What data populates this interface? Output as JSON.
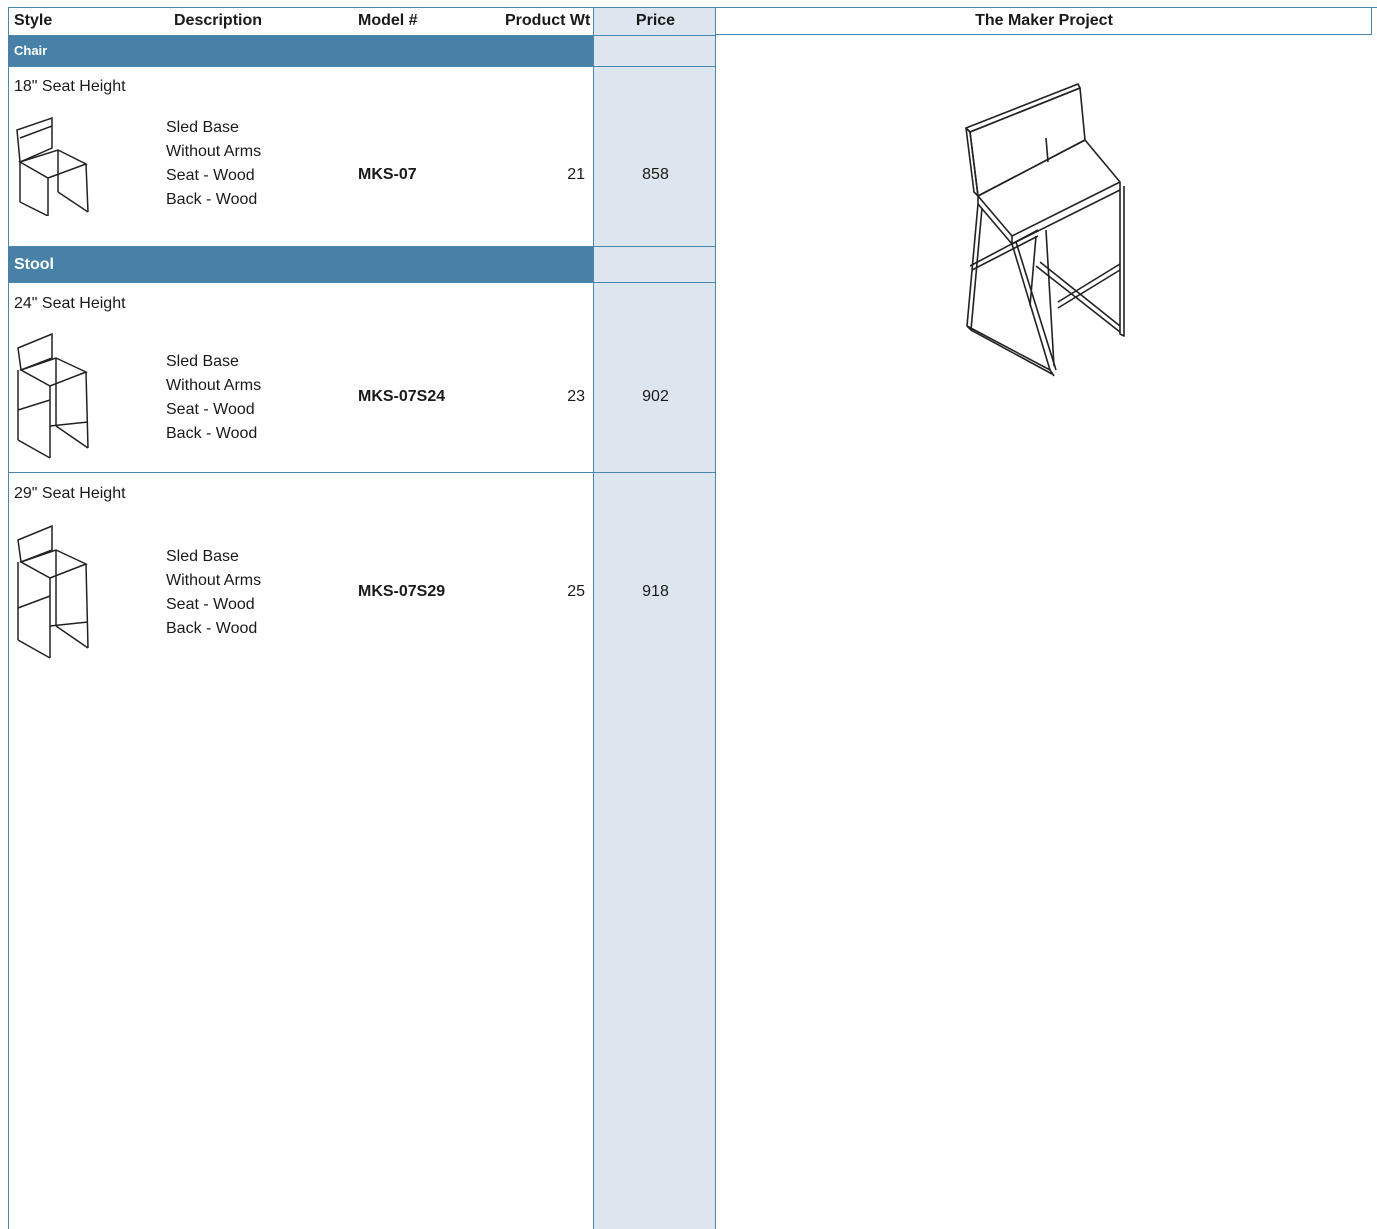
{
  "header": {
    "style": "Style",
    "description": "Description",
    "model": "Model #",
    "weight": "Product Wt",
    "price": "Price",
    "brand": "The Maker Project"
  },
  "groups": [
    {
      "name": "Chair",
      "items": [
        {
          "seat_height": "18\" Seat Height",
          "description": [
            "Sled Base",
            "Without Arms",
            "Seat - Wood",
            "Back - Wood"
          ],
          "model": "MKS-07",
          "weight": "21",
          "price": "858",
          "icon": "chair-icon"
        }
      ]
    },
    {
      "name": "Stool",
      "items": [
        {
          "seat_height": "24\" Seat Height",
          "description": [
            "Sled Base",
            "Without Arms",
            "Seat - Wood",
            "Back - Wood"
          ],
          "model": "MKS-07S24",
          "weight": "23",
          "price": "902",
          "icon": "stool-icon"
        },
        {
          "seat_height": "29\" Seat Height",
          "description": [
            "Sled Base",
            "Without Arms",
            "Seat - Wood",
            "Back - Wood"
          ],
          "model": "MKS-07S29",
          "weight": "25",
          "price": "918",
          "icon": "stool-icon"
        }
      ]
    }
  ],
  "colors": {
    "band": "#4781a8",
    "price_column": "#dde5ee",
    "grid_line": "#4a86ad"
  },
  "hero_icon": "bar-stool-illustration-icon"
}
